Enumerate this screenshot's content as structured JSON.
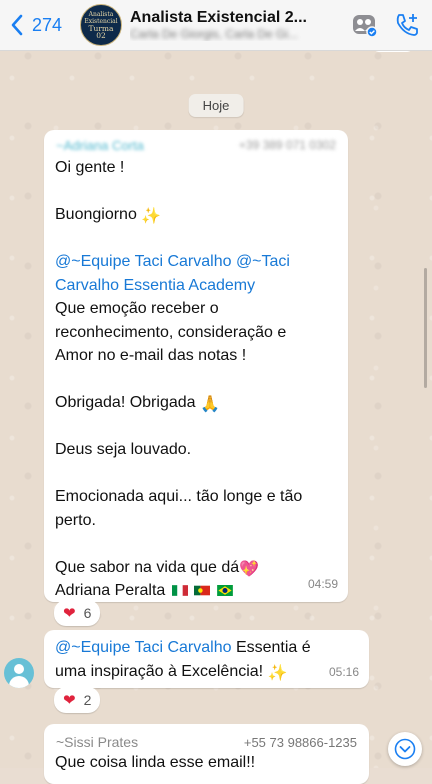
{
  "header": {
    "back_count": "274",
    "title": "Analista Existencial 2...",
    "subtitle": "Carla De Giorgis, Carla De Gi...",
    "avatar_lines": [
      "Analista",
      "Existencial",
      "Turma",
      "02"
    ]
  },
  "date_chip": "Hoje",
  "message1": {
    "sender": "~Adriana Corta",
    "phone": "+39 389 071 0302",
    "lines": [
      "Oi gente !",
      "",
      "Buongiorno",
      "",
      "",
      "Que emoção receber o",
      "reconhecimento, consideração e",
      "Amor no e-mail das notas !",
      "",
      "Obrigada! Obrigada",
      "",
      "Deus seja louvado.",
      "",
      "Emocionada aqui... tão longe e tão",
      "perto.",
      "",
      "Que sabor na vida que dá",
      "Adriana Peralta"
    ],
    "mention_line_a": "@~Equipe Taci Carvalho @~Taci",
    "mention_line_b": "Carvalho Essentia Academy",
    "time": "04:59",
    "reaction_count": "6"
  },
  "message2": {
    "mention": "@~Equipe Taci Carvalho",
    "text_a": " Essentia é",
    "text_b": "uma inspiração à Excelência!",
    "time": "05:16",
    "reaction_count": "2"
  },
  "message3": {
    "sender": "~Sissi Prates",
    "phone": "+55 73 98866-1235",
    "text": "Que coisa linda esse email!!"
  },
  "icons": {
    "back": "chevron-left-icon",
    "community": "group-icon",
    "call": "add-call-icon",
    "scroll": "chevron-down-icon"
  },
  "colors": {
    "accent": "#1a7ff2",
    "mention": "#1879d6",
    "heart": "#e0233d"
  }
}
